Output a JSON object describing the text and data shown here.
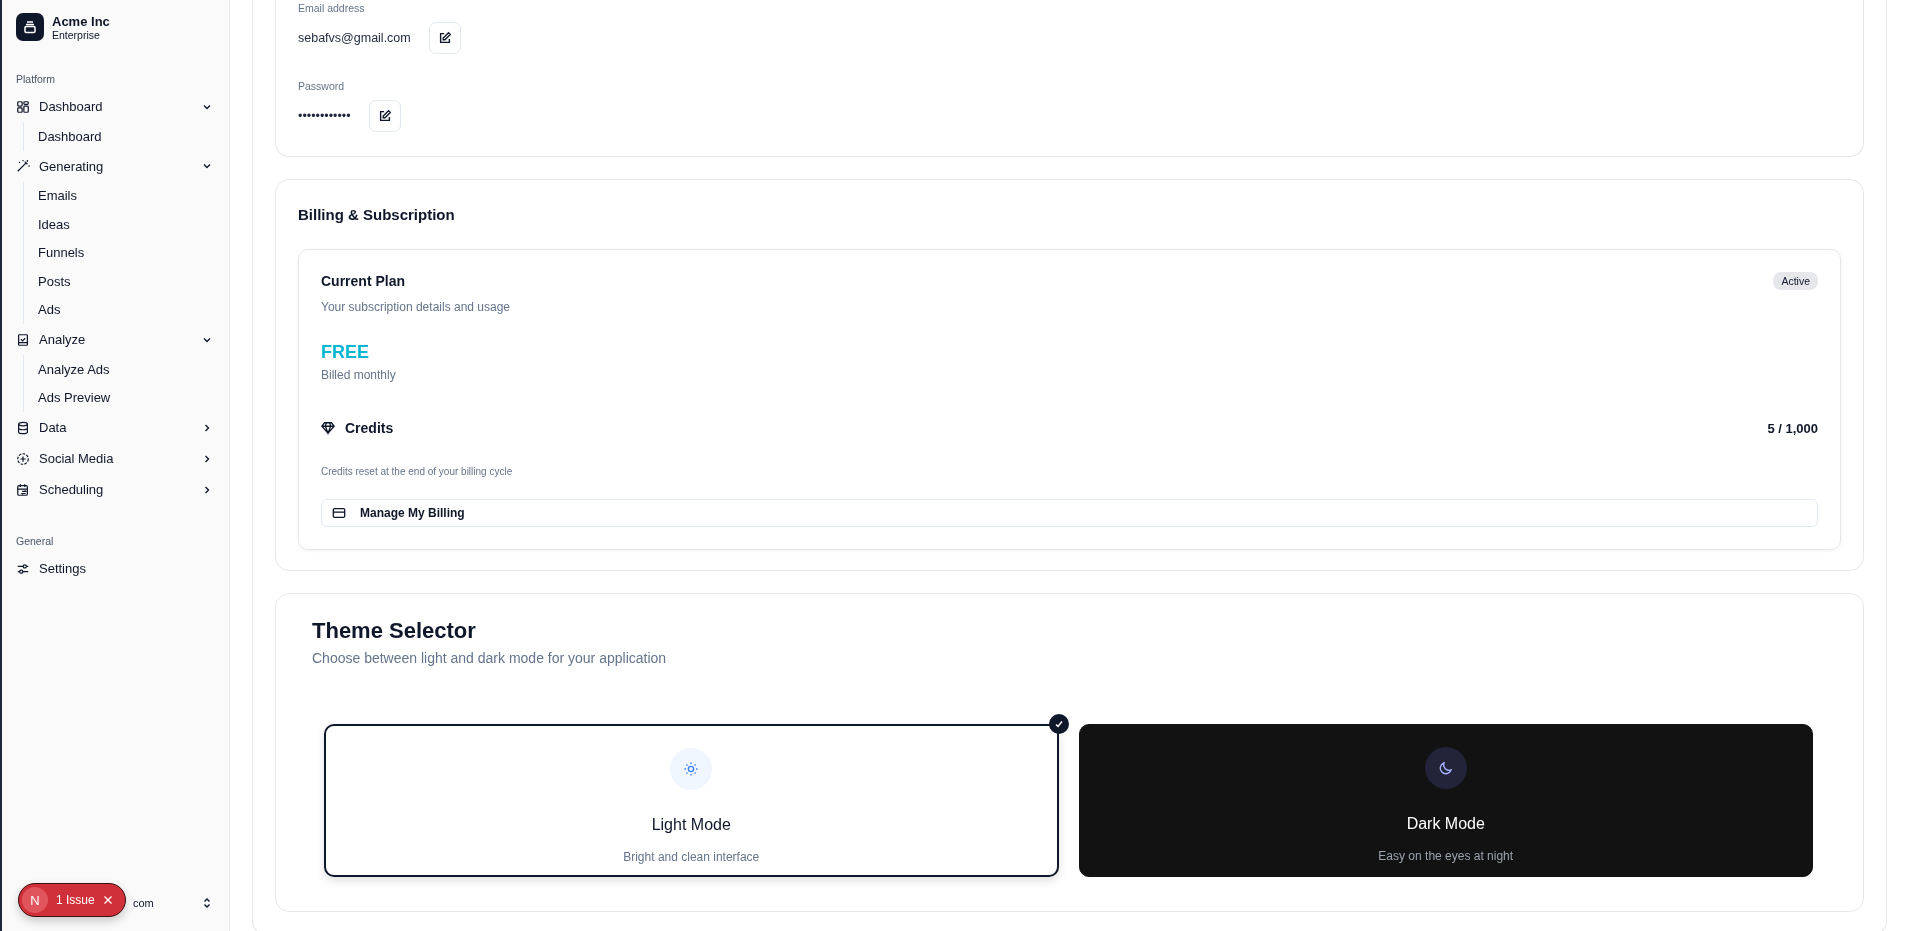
{
  "sidebar": {
    "brand": {
      "name": "Acme Inc",
      "plan": "Enterprise"
    },
    "groups": [
      {
        "label": "Platform",
        "items": [
          {
            "label": "Dashboard",
            "kind": "grid",
            "expanded": true,
            "children": [
              {
                "label": "Dashboard"
              }
            ]
          },
          {
            "label": "Generating",
            "kind": "wand",
            "expanded": true,
            "children": [
              {
                "label": "Emails"
              },
              {
                "label": "Ideas"
              },
              {
                "label": "Funnels"
              },
              {
                "label": "Posts"
              },
              {
                "label": "Ads"
              }
            ]
          },
          {
            "label": "Analyze",
            "kind": "clipboard",
            "expanded": true,
            "children": [
              {
                "label": "Analyze Ads"
              },
              {
                "label": "Ads Preview"
              }
            ]
          },
          {
            "label": "Data",
            "kind": "database",
            "expanded": false
          },
          {
            "label": "Social Media",
            "kind": "plus-circle",
            "expanded": false
          },
          {
            "label": "Scheduling",
            "kind": "calendar",
            "expanded": false
          }
        ]
      },
      {
        "label": "General",
        "items": [
          {
            "label": "Settings",
            "kind": "sliders"
          }
        ]
      }
    ],
    "footer": {
      "email": "com"
    }
  },
  "account": {
    "fields": [
      {
        "label": "Email address",
        "value": "sebafvs@gmail.com"
      },
      {
        "label": "Password",
        "value": "••••••••••••"
      }
    ]
  },
  "billing": {
    "title": "Billing & Subscription",
    "plan_card": {
      "title": "Current Plan",
      "subtitle": "Your subscription details and usage",
      "status": "Active",
      "plan": "FREE",
      "cycle": "Billed monthly",
      "credits_label": "Credits",
      "credits": "5 / 1,000",
      "credits_note": "Credits reset at the end of your billing cycle",
      "button": "Manage My Billing"
    }
  },
  "theme": {
    "title": "Theme Selector",
    "subtitle": "Choose between light and dark mode for your application",
    "options": [
      {
        "kind": "light",
        "label": "Light Mode",
        "description": "Bright and clean interface",
        "selected": true
      },
      {
        "kind": "dark",
        "label": "Dark Mode",
        "description": "Easy on the eyes at night",
        "selected": false
      }
    ]
  },
  "issue_badge": {
    "avatar": "N",
    "label": "1 Issue"
  }
}
